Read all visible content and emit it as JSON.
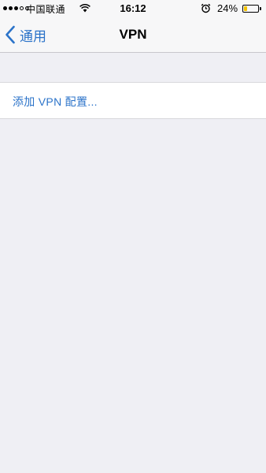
{
  "status_bar": {
    "carrier": "中国联通",
    "time": "16:12",
    "battery_percent": "24%",
    "battery_level": 0.24,
    "battery_color": "#f2c200",
    "icons": [
      "signal-dots-icon",
      "wifi-icon",
      "alarm-icon",
      "battery-icon"
    ]
  },
  "nav": {
    "back_label": "通用",
    "title": "VPN",
    "accent_color": "#2b73c9"
  },
  "main": {
    "add_vpn_label": "添加 VPN 配置..."
  }
}
